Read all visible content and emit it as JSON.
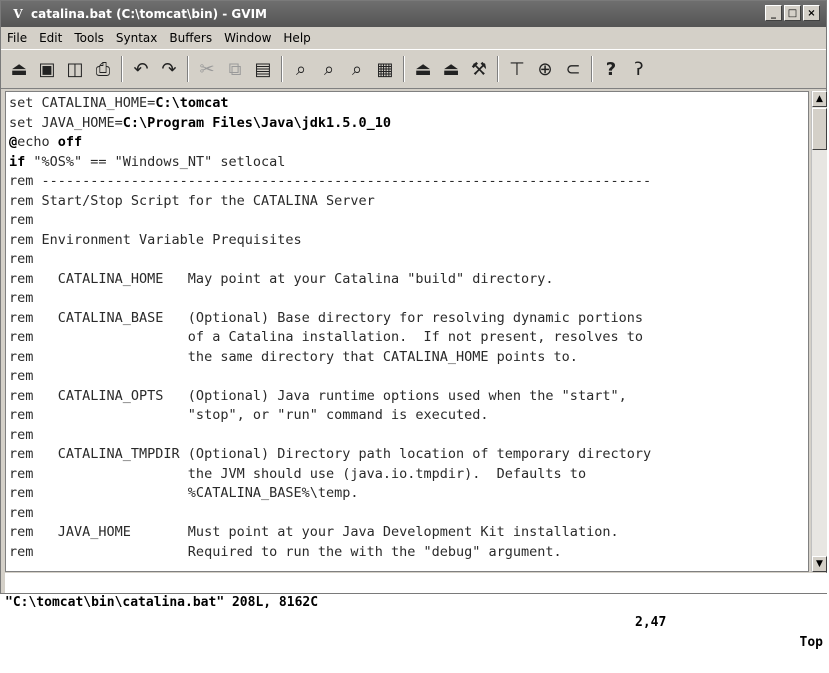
{
  "window": {
    "title": "catalina.bat (C:\\tomcat\\bin) - GVIM",
    "app_icon": "vim-icon",
    "controls": [
      "minimize",
      "maximize",
      "close"
    ]
  },
  "menu": {
    "items": [
      "File",
      "Edit",
      "Tools",
      "Syntax",
      "Buffers",
      "Window",
      "Help"
    ]
  },
  "toolbar": {
    "groups": [
      [
        "open-icon",
        "save-icon",
        "save-all-icon",
        "print-icon"
      ],
      [
        "undo-icon",
        "redo-icon"
      ],
      [
        "cut-icon",
        "copy-icon",
        "paste-icon"
      ],
      [
        "find-icon",
        "find-next-icon",
        "find-prev-icon",
        "load-session-icon"
      ],
      [
        "save-session-icon",
        "run-script-icon",
        "make-icon"
      ],
      [
        "shell-icon",
        "make-tags-icon",
        "jump-tag-icon"
      ],
      [
        "help-icon",
        "find-help-icon"
      ]
    ]
  },
  "buffer": {
    "lines": [
      "set CATALINA_HOME=C:\\tomcat",
      "set JAVA_HOME=C:\\Program Files\\Java\\jdk1.5.0_10",
      "@echo off",
      "if \"%OS%\" == \"Windows_NT\" setlocal",
      "rem ---------------------------------------------------------------------------",
      "rem Start/Stop Script for the CATALINA Server",
      "rem",
      "rem Environment Variable Prequisites",
      "rem",
      "rem   CATALINA_HOME   May point at your Catalina \"build\" directory.",
      "rem",
      "rem   CATALINA_BASE   (Optional) Base directory for resolving dynamic portions",
      "rem                   of a Catalina installation.  If not present, resolves to",
      "rem                   the same directory that CATALINA_HOME points to.",
      "rem",
      "rem   CATALINA_OPTS   (Optional) Java runtime options used when the \"start\",",
      "rem                   \"stop\", or \"run\" command is executed.",
      "rem",
      "rem   CATALINA_TMPDIR (Optional) Directory path location of temporary directory",
      "rem                   the JVM should use (java.io.tmpdir).  Defaults to",
      "rem                   %CATALINA_BASE%\\temp.",
      "rem",
      "rem   JAVA_HOME       Must point at your Java Development Kit installation.",
      "rem                   Required to run the with the \"debug\" argument."
    ]
  },
  "status": {
    "file_info": "\"C:\\tomcat\\bin\\catalina.bat\" 208L, 8162C",
    "cursor": "2,47",
    "scroll": "Top"
  }
}
